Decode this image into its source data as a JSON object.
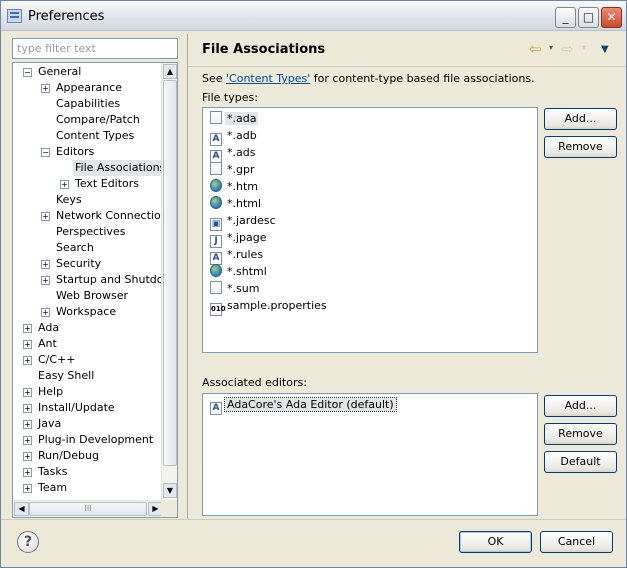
{
  "window": {
    "title": "Preferences",
    "minimize_glyph": "_",
    "maximize_glyph": "□",
    "close_glyph": "✕"
  },
  "sidebar": {
    "filter_placeholder": "type filter text",
    "tree": [
      {
        "label": "General",
        "level": 0,
        "expander": "−"
      },
      {
        "label": "Appearance",
        "level": 1,
        "expander": "+"
      },
      {
        "label": "Capabilities",
        "level": 1,
        "expander": ""
      },
      {
        "label": "Compare/Patch",
        "level": 1,
        "expander": ""
      },
      {
        "label": "Content Types",
        "level": 1,
        "expander": ""
      },
      {
        "label": "Editors",
        "level": 1,
        "expander": "−"
      },
      {
        "label": "File Associations",
        "level": 2,
        "expander": "",
        "selected": true
      },
      {
        "label": "Text Editors",
        "level": 2,
        "expander": "+"
      },
      {
        "label": "Keys",
        "level": 1,
        "expander": ""
      },
      {
        "label": "Network Connections",
        "level": 1,
        "expander": "+"
      },
      {
        "label": "Perspectives",
        "level": 1,
        "expander": ""
      },
      {
        "label": "Search",
        "level": 1,
        "expander": ""
      },
      {
        "label": "Security",
        "level": 1,
        "expander": "+"
      },
      {
        "label": "Startup and Shutdown",
        "level": 1,
        "expander": "+"
      },
      {
        "label": "Web Browser",
        "level": 1,
        "expander": ""
      },
      {
        "label": "Workspace",
        "level": 1,
        "expander": "+"
      },
      {
        "label": "Ada",
        "level": 0,
        "expander": "+"
      },
      {
        "label": "Ant",
        "level": 0,
        "expander": "+"
      },
      {
        "label": "C/C++",
        "level": 0,
        "expander": "+"
      },
      {
        "label": "Easy Shell",
        "level": 0,
        "expander": ""
      },
      {
        "label": "Help",
        "level": 0,
        "expander": "+"
      },
      {
        "label": "Install/Update",
        "level": 0,
        "expander": "+"
      },
      {
        "label": "Java",
        "level": 0,
        "expander": "+"
      },
      {
        "label": "Plug-in Development",
        "level": 0,
        "expander": "+"
      },
      {
        "label": "Run/Debug",
        "level": 0,
        "expander": "+"
      },
      {
        "label": "Tasks",
        "level": 0,
        "expander": "+"
      },
      {
        "label": "Team",
        "level": 0,
        "expander": "+"
      }
    ],
    "scroll_up_glyph": "▲",
    "scroll_down_glyph": "▼",
    "scroll_left_glyph": "◀",
    "scroll_right_glyph": "▶",
    "grip_glyph": "III"
  },
  "page": {
    "title": "File Associations",
    "nav_back_glyph": "⇦",
    "nav_forward_glyph": "⇨",
    "dropdown_glyph": "▾",
    "view_menu_glyph": "▼",
    "see_prefix": "See ",
    "see_link": "'Content Types'",
    "see_suffix": " for content-type based file associations.",
    "file_types_label": "File types:",
    "file_types": [
      {
        "name": "*.ada",
        "icon": "doc",
        "glyph": "",
        "selected": true
      },
      {
        "name": "*.adb",
        "icon": "ada",
        "glyph": "A"
      },
      {
        "name": "*.ads",
        "icon": "ada",
        "glyph": "A"
      },
      {
        "name": "*.gpr",
        "icon": "doc",
        "glyph": ""
      },
      {
        "name": "*.htm",
        "icon": "globe",
        "glyph": ""
      },
      {
        "name": "*.html",
        "icon": "globe",
        "glyph": ""
      },
      {
        "name": "*.jardesc",
        "icon": "jar",
        "glyph": "▣"
      },
      {
        "name": "*.jpage",
        "icon": "java",
        "glyph": "J"
      },
      {
        "name": "*.rules",
        "icon": "ada",
        "glyph": "A"
      },
      {
        "name": "*.shtml",
        "icon": "globe",
        "glyph": ""
      },
      {
        "name": "*.sum",
        "icon": "doc",
        "glyph": ""
      },
      {
        "name": "sample.properties",
        "icon": "bin",
        "glyph": "010"
      }
    ],
    "file_add_label": "Add...",
    "file_remove_label": "Remove",
    "associated_editors_label": "Associated editors:",
    "editors": [
      {
        "name": "AdaCore's Ada Editor (default)",
        "icon": "ada",
        "glyph": "A"
      }
    ],
    "editor_add_label": "Add...",
    "editor_remove_label": "Remove",
    "editor_default_label": "Default"
  },
  "footer": {
    "help_glyph": "?",
    "ok_label": "OK",
    "cancel_label": "Cancel"
  }
}
